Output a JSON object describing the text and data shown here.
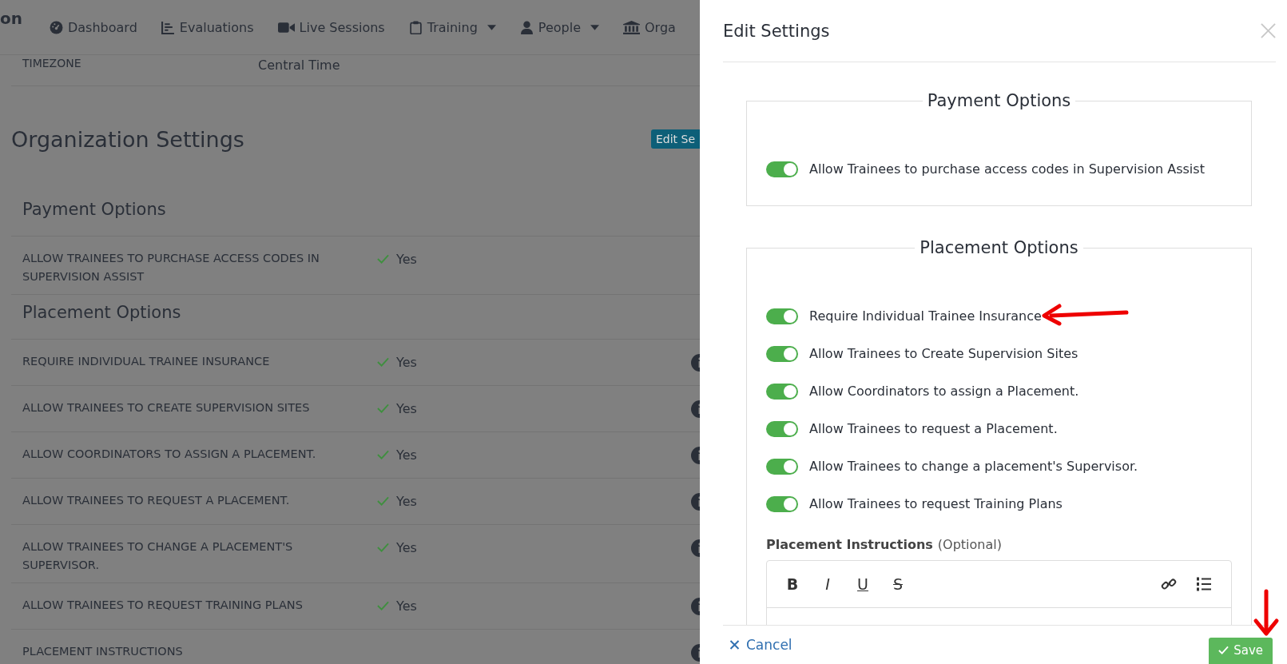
{
  "brand": "on",
  "nav": [
    {
      "label": "Dashboard",
      "kind": "gauge",
      "dropdown": false
    },
    {
      "label": "Evaluations",
      "kind": "chart",
      "dropdown": false
    },
    {
      "label": "Live Sessions",
      "kind": "video",
      "dropdown": false
    },
    {
      "label": "Training",
      "kind": "clipboard",
      "dropdown": true
    },
    {
      "label": "People",
      "kind": "person",
      "dropdown": true
    },
    {
      "label": "Orga",
      "kind": "bank",
      "dropdown": false
    }
  ],
  "timezone": {
    "label": "TIMEZONE",
    "value": "Central Time"
  },
  "page_title": "Organization Settings",
  "edit_button": "Edit Se",
  "sections": [
    {
      "title": "Payment Options",
      "rows": [
        {
          "label": "ALLOW TRAINEES TO PURCHASE ACCESS CODES IN SUPERVISION ASSIST",
          "value": "Yes",
          "info": false
        }
      ]
    },
    {
      "title": "Placement Options",
      "rows": [
        {
          "label": "REQUIRE INDIVIDUAL TRAINEE INSURANCE",
          "value": "Yes",
          "info": true
        },
        {
          "label": "ALLOW TRAINEES TO CREATE SUPERVISION SITES",
          "value": "Yes",
          "info": true
        },
        {
          "label": "ALLOW COORDINATORS TO ASSIGN A PLACEMENT.",
          "value": "Yes",
          "info": true
        },
        {
          "label": "ALLOW TRAINEES TO REQUEST A PLACEMENT.",
          "value": "Yes",
          "info": true
        },
        {
          "label": "ALLOW TRAINEES TO CHANGE A PLACEMENT'S SUPERVISOR.",
          "value": "Yes",
          "info": true
        },
        {
          "label": "ALLOW TRAINEES TO REQUEST TRAINING PLANS",
          "value": "Yes",
          "info": true
        },
        {
          "label": "PLACEMENT INSTRUCTIONS",
          "value": "",
          "info": true
        }
      ]
    }
  ],
  "drawer": {
    "title": "Edit Settings",
    "groups": [
      {
        "legend": "Payment Options",
        "toggles": [
          {
            "label": "Allow Trainees to purchase access codes in Supervision Assist",
            "on": true
          }
        ]
      },
      {
        "legend": "Placement Options",
        "toggles": [
          {
            "label": "Require Individual Trainee Insurance",
            "on": true
          },
          {
            "label": "Allow Trainees to Create Supervision Sites",
            "on": true
          },
          {
            "label": "Allow Coordinators to assign a Placement.",
            "on": true
          },
          {
            "label": "Allow Trainees to request a Placement.",
            "on": true
          },
          {
            "label": "Allow Trainees to change a placement's Supervisor.",
            "on": true
          },
          {
            "label": "Allow Trainees to request Training Plans",
            "on": true
          }
        ]
      }
    ],
    "instructions_label": "Placement Instructions",
    "instructions_hint": "(Optional)",
    "toolbar": [
      {
        "glyph": "B",
        "kind": "bold"
      },
      {
        "glyph": "I",
        "kind": "italic"
      },
      {
        "glyph": "U",
        "kind": "underline"
      },
      {
        "glyph": "S",
        "kind": "strike"
      },
      {
        "kind": "link"
      },
      {
        "kind": "list"
      }
    ],
    "cancel": "Cancel",
    "save": "Save"
  }
}
